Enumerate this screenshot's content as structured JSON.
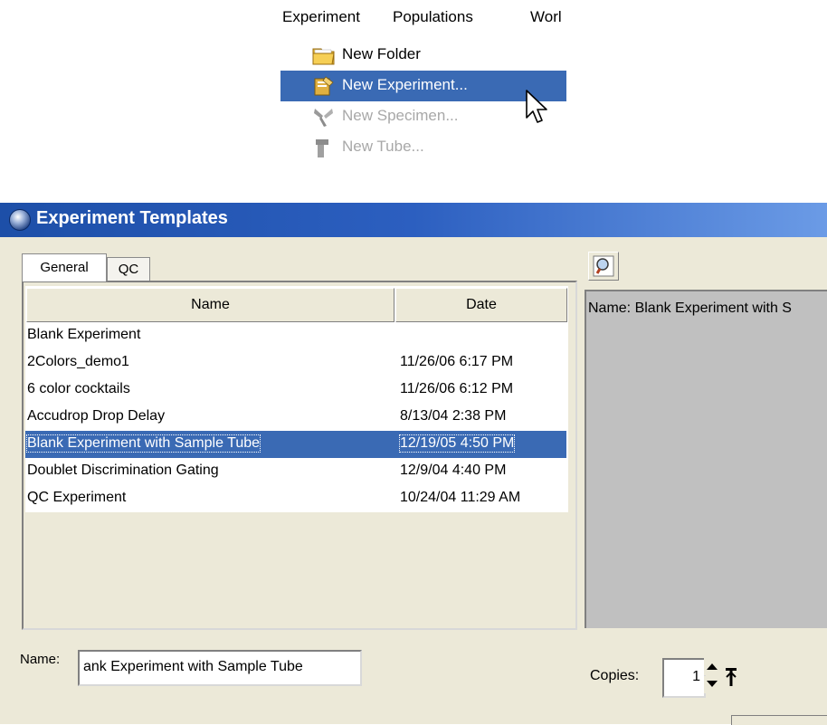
{
  "menubar": {
    "items": [
      "Experiment",
      "Populations",
      "Worl"
    ]
  },
  "dropdown": {
    "items": [
      {
        "label": "New Folder",
        "icon": "folder-icon",
        "state": "normal"
      },
      {
        "label": "New Experiment...",
        "icon": "experiment-icon",
        "state": "selected"
      },
      {
        "label": "New Specimen...",
        "icon": "specimen-icon",
        "state": "disabled"
      },
      {
        "label": "New Tube...",
        "icon": "tube-icon",
        "state": "disabled"
      }
    ]
  },
  "window": {
    "title": "Experiment Templates",
    "tabs": [
      {
        "label": "General",
        "active": true
      },
      {
        "label": "QC",
        "active": false
      }
    ],
    "table": {
      "columns": [
        "Name",
        "Date"
      ],
      "rows": [
        {
          "name": "Blank Experiment",
          "date": ""
        },
        {
          "name": "2Colors_demo1",
          "date": "11/26/06 6:17 PM"
        },
        {
          "name": "6 color cocktails",
          "date": "11/26/06 6:12 PM"
        },
        {
          "name": "Accudrop Drop Delay",
          "date": "8/13/04 2:38 PM"
        },
        {
          "name": "Blank Experiment with Sample Tube",
          "date": "12/19/05 4:50 PM"
        },
        {
          "name": "Doublet Discrimination Gating",
          "date": "12/9/04 4:40 PM"
        },
        {
          "name": "QC Experiment",
          "date": "10/24/04 11:29 AM"
        }
      ],
      "selected_row": 4
    },
    "preview": {
      "text": "Name: Blank Experiment with S"
    },
    "name_label": "Name:",
    "name_value": "ank Experiment with Sample Tube",
    "copies_label": "Copies:",
    "copies_value": "1"
  },
  "colors": {
    "selection": "#3a6ab4",
    "titlebar": "#2c5fc0",
    "dialog_bg": "#ece9d8",
    "preview_bg": "#c0c0c0"
  }
}
